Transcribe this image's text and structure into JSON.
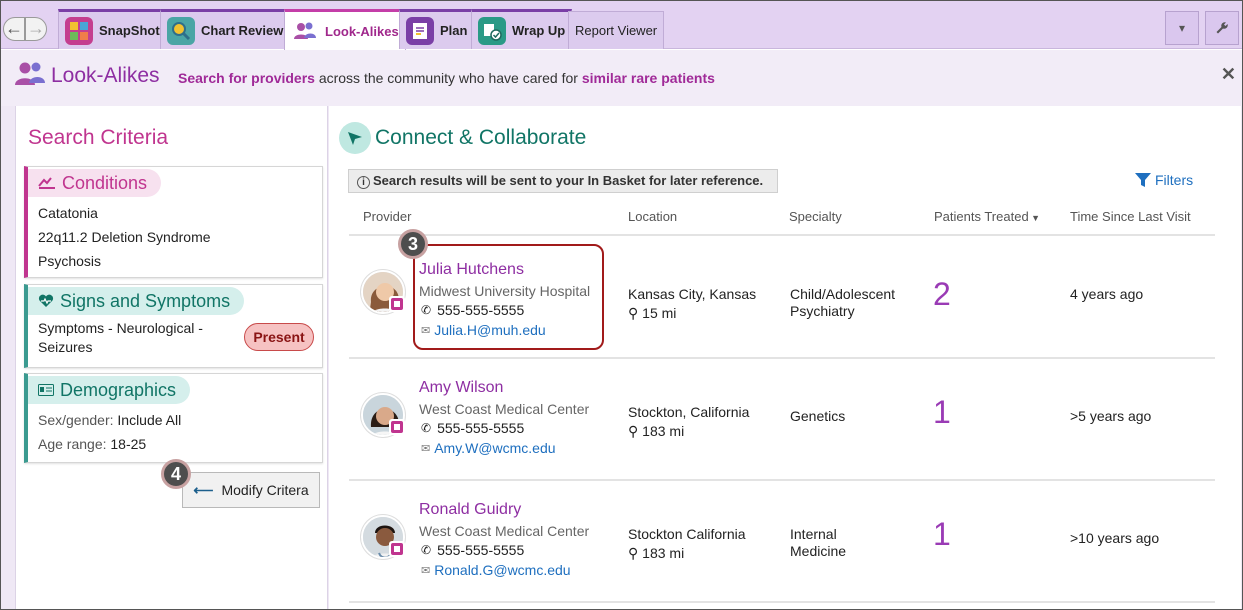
{
  "tabs": [
    {
      "label": "SnapShot",
      "icon": "snapshot-icon"
    },
    {
      "label": "Chart Review",
      "icon": "chart-review-icon"
    },
    {
      "label": "Look-Alikes",
      "icon": "people-icon"
    },
    {
      "label": "Plan",
      "icon": "plan-icon"
    },
    {
      "label": "Wrap Up",
      "icon": "wrap-up-icon"
    },
    {
      "label": "Report Viewer"
    }
  ],
  "header": {
    "title": "Look-Alikes",
    "desc_part1": "Search for providers",
    "desc_part2": " across the community who have cared for ",
    "desc_part3": "similar rare patients"
  },
  "search_criteria": {
    "title": "Search Criteria",
    "conditions": {
      "label": "Conditions",
      "items": [
        "Catatonia",
        "22q11.2 Deletion Syndrome",
        "Psychosis"
      ]
    },
    "signs": {
      "label": "Signs and Symptoms",
      "item_line1": "Symptoms - Neurological -",
      "item_line2": "Seizures",
      "status": "Present"
    },
    "demographics": {
      "label": "Demographics",
      "sex_label": "Sex/gender:",
      "sex_value": "Include All",
      "age_label": "Age range:",
      "age_value": "18-25"
    },
    "modify_label": "Modify Critera"
  },
  "callouts": {
    "three": "3",
    "four": "4"
  },
  "results": {
    "title": "Connect & Collaborate",
    "info": "Search results will be sent to your In Basket for later reference.",
    "filters_label": "Filters",
    "columns": {
      "provider": "Provider",
      "location": "Location",
      "specialty": "Specialty",
      "patients": "Patients Treated",
      "since": "Time Since Last Visit"
    },
    "rows": [
      {
        "name": "Julia Hutchens",
        "hospital": "Midwest University Hospital",
        "phone": "555-555-5555",
        "email": "Julia.H@muh.edu",
        "city": "Kansas City, Kansas",
        "distance": "15 mi",
        "specialty_line1": "Child/Adolescent",
        "specialty_line2": "Psychiatry",
        "patients": "2",
        "since": "4 years ago"
      },
      {
        "name": "Amy Wilson",
        "hospital": "West Coast Medical Center",
        "phone": "555-555-5555",
        "email": "Amy.W@wcmc.edu",
        "city": "Stockton, California",
        "distance": "183 mi",
        "specialty_line1": "Genetics",
        "specialty_line2": "",
        "patients": "1",
        "since": ">5 years ago"
      },
      {
        "name": "Ronald Guidry",
        "hospital": "West Coast Medical Center",
        "phone": "555-555-5555",
        "email": "Ronald.G@wcmc.edu",
        "city": "Stockton California",
        "distance": "183 mi",
        "specialty_line1": "Internal",
        "specialty_line2": "Medicine",
        "patients": "1",
        "since": ">10 years ago"
      }
    ]
  },
  "colors": {
    "brand_purple": "#8e2ea2",
    "teal": "#117566",
    "pink": "#c0358f",
    "link": "#1e6fbf"
  }
}
